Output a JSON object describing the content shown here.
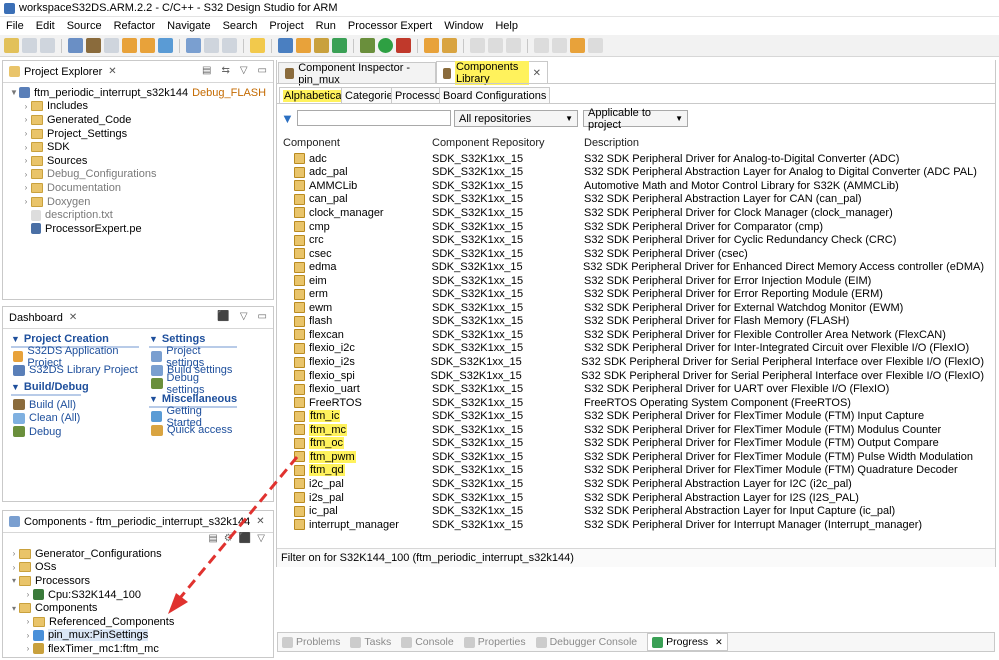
{
  "window": {
    "title": "workspaceS32DS.ARM.2.2 - C/C++ - S32 Design Studio for ARM"
  },
  "menu": [
    "File",
    "Edit",
    "Source",
    "Refactor",
    "Navigate",
    "Search",
    "Project",
    "Run",
    "Processor Expert",
    "Window",
    "Help"
  ],
  "project_explorer": {
    "tab_label": "Project Explorer",
    "root": {
      "name": "ftm_periodic_interrupt_s32k144",
      "config": "Debug_FLASH"
    },
    "items": [
      {
        "label": "Includes",
        "style": "normal"
      },
      {
        "label": "Generated_Code",
        "style": "normal"
      },
      {
        "label": "Project_Settings",
        "style": "normal"
      },
      {
        "label": "SDK",
        "style": "normal"
      },
      {
        "label": "Sources",
        "style": "normal"
      },
      {
        "label": "Debug_Configurations",
        "style": "gray"
      },
      {
        "label": "Documentation",
        "style": "gray"
      },
      {
        "label": "Doxygen",
        "style": "gray"
      },
      {
        "label": "description.txt",
        "style": "gray"
      },
      {
        "label": "ProcessorExpert.pe",
        "style": "normal"
      }
    ]
  },
  "dashboard": {
    "tab_label": "Dashboard",
    "project_creation": {
      "title": "Project Creation",
      "links": [
        "S32DS Application Project",
        "S32DS Library Project"
      ]
    },
    "settings": {
      "title": "Settings",
      "links": [
        "Project settings",
        "Build settings",
        "Debug settings"
      ]
    },
    "build_debug": {
      "title": "Build/Debug",
      "links": [
        "Build  (All)",
        "Clean  (All)",
        "Debug"
      ]
    },
    "misc": {
      "title": "Miscellaneous",
      "links": [
        "Getting Started",
        "Quick access"
      ]
    }
  },
  "components_view": {
    "tab_label": "Components - ftm_periodic_interrupt_s32k144",
    "items": [
      {
        "label": "Generator_Configurations",
        "level": 0
      },
      {
        "label": "OSs",
        "level": 0
      },
      {
        "label": "Processors",
        "level": 0
      },
      {
        "label": "Cpu:S32K144_100",
        "level": 1
      },
      {
        "label": "Components",
        "level": 0
      },
      {
        "label": "Referenced_Components",
        "level": 1
      },
      {
        "label": "pin_mux:PinSettings",
        "level": 1
      },
      {
        "label": "flexTimer_mc1:ftm_mc",
        "level": 1
      }
    ]
  },
  "editor_tabs": [
    "Component Inspector - pin_mux",
    "Components Library"
  ],
  "library": {
    "subtabs": [
      "Alphabetical",
      "Categories",
      "Processors",
      "Board Configurations"
    ],
    "repo_select": "All repositories",
    "applicable_select": "Applicable to project",
    "columns": [
      "Component",
      "Component Repository",
      "Description"
    ],
    "rows": [
      {
        "name": "adc",
        "repo": "SDK_S32K1xx_15",
        "desc": "S32 SDK Peripheral Driver for Analog-to-Digital Converter (ADC)",
        "hl": false
      },
      {
        "name": "adc_pal",
        "repo": "SDK_S32K1xx_15",
        "desc": "S32 SDK Peripheral Abstraction Layer for Analog to Digital Converter (ADC PAL)",
        "hl": false
      },
      {
        "name": "AMMCLib",
        "repo": "SDK_S32K1xx_15",
        "desc": "Automotive Math and Motor Control Library for S32K (AMMCLib)",
        "hl": false
      },
      {
        "name": "can_pal",
        "repo": "SDK_S32K1xx_15",
        "desc": "S32 SDK Peripheral Abstraction Layer for CAN (can_pal)",
        "hl": false
      },
      {
        "name": "clock_manager",
        "repo": "SDK_S32K1xx_15",
        "desc": "S32 SDK Peripheral Driver for Clock Manager (clock_manager)",
        "hl": false
      },
      {
        "name": "cmp",
        "repo": "SDK_S32K1xx_15",
        "desc": "S32 SDK Peripheral Driver for Comparator (cmp)",
        "hl": false
      },
      {
        "name": "crc",
        "repo": "SDK_S32K1xx_15",
        "desc": "S32 SDK Peripheral Driver for Cyclic Redundancy Check (CRC)",
        "hl": false
      },
      {
        "name": "csec",
        "repo": "SDK_S32K1xx_15",
        "desc": "S32 SDK Peripheral Driver (csec)",
        "hl": false
      },
      {
        "name": "edma",
        "repo": "SDK_S32K1xx_15",
        "desc": "S32 SDK Peripheral Driver for Enhanced Direct Memory Access controller (eDMA)",
        "hl": false
      },
      {
        "name": "eim",
        "repo": "SDK_S32K1xx_15",
        "desc": "S32 SDK Peripheral Driver for Error Injection Module (EIM)",
        "hl": false
      },
      {
        "name": "erm",
        "repo": "SDK_S32K1xx_15",
        "desc": "S32 SDK Peripheral Driver for Error Reporting Module (ERM)",
        "hl": false
      },
      {
        "name": "ewm",
        "repo": "SDK_S32K1xx_15",
        "desc": "S32 SDK Peripheral Driver for External Watchdog Monitor (EWM)",
        "hl": false
      },
      {
        "name": "flash",
        "repo": "SDK_S32K1xx_15",
        "desc": "S32 SDK Peripheral Driver for Flash Memory (FLASH)",
        "hl": false
      },
      {
        "name": "flexcan",
        "repo": "SDK_S32K1xx_15",
        "desc": "S32 SDK Peripheral Driver for Flexible Controller Area Network (FlexCAN)",
        "hl": false
      },
      {
        "name": "flexio_i2c",
        "repo": "SDK_S32K1xx_15",
        "desc": "S32 SDK Peripheral Driver for Inter-Integrated Circuit over Flexible I/O (FlexIO)",
        "hl": false
      },
      {
        "name": "flexio_i2s",
        "repo": "SDK_S32K1xx_15",
        "desc": "S32 SDK Peripheral Driver for Serial Peripheral Interface over Flexible I/O (FlexIO)",
        "hl": false
      },
      {
        "name": "flexio_spi",
        "repo": "SDK_S32K1xx_15",
        "desc": "S32 SDK Peripheral Driver for Serial Peripheral Interface over Flexible I/O (FlexIO)",
        "hl": false
      },
      {
        "name": "flexio_uart",
        "repo": "SDK_S32K1xx_15",
        "desc": "S32 SDK Peripheral Driver for UART over Flexible I/O (FlexIO)",
        "hl": false
      },
      {
        "name": "FreeRTOS",
        "repo": "SDK_S32K1xx_15",
        "desc": "FreeRTOS Operating System Component (FreeRTOS)",
        "hl": false
      },
      {
        "name": "ftm_ic",
        "repo": "SDK_S32K1xx_15",
        "desc": "S32 SDK Peripheral Driver for FlexTimer Module (FTM) Input Capture",
        "hl": true
      },
      {
        "name": "ftm_mc",
        "repo": "SDK_S32K1xx_15",
        "desc": "S32 SDK Peripheral Driver for FlexTimer Module (FTM) Modulus Counter",
        "hl": true
      },
      {
        "name": "ftm_oc",
        "repo": "SDK_S32K1xx_15",
        "desc": "S32 SDK Peripheral Driver for FlexTimer Module (FTM) Output Compare",
        "hl": true
      },
      {
        "name": "ftm_pwm",
        "repo": "SDK_S32K1xx_15",
        "desc": "S32 SDK Peripheral Driver for FlexTimer Module (FTM) Pulse Width Modulation",
        "hl": true
      },
      {
        "name": "ftm_qd",
        "repo": "SDK_S32K1xx_15",
        "desc": "S32 SDK Peripheral Driver for FlexTimer Module (FTM) Quadrature Decoder",
        "hl": true
      },
      {
        "name": "i2c_pal",
        "repo": "SDK_S32K1xx_15",
        "desc": "S32 SDK Peripheral Abstraction Layer for I2C (i2c_pal)",
        "hl": false
      },
      {
        "name": "i2s_pal",
        "repo": "SDK_S32K1xx_15",
        "desc": "S32 SDK Peripheral Abstraction Layer for I2S (I2S_PAL)",
        "hl": false
      },
      {
        "name": "ic_pal",
        "repo": "SDK_S32K1xx_15",
        "desc": "S32 SDK Peripheral Abstraction Layer for Input Capture (ic_pal)",
        "hl": false
      },
      {
        "name": "interrupt_manager",
        "repo": "SDK_S32K1xx_15",
        "desc": "S32 SDK Peripheral Driver for Interrupt Manager (Interrupt_manager)",
        "hl": false
      }
    ],
    "status": "Filter on for S32K144_100 (ftm_periodic_interrupt_s32k144)"
  },
  "bottom_tabs": [
    "Problems",
    "Tasks",
    "Console",
    "Properties",
    "Debugger Console",
    "Progress"
  ],
  "colors": {
    "highlight": "#fff25c",
    "link": "#1e4f9c",
    "arrow": "#e0322f"
  }
}
